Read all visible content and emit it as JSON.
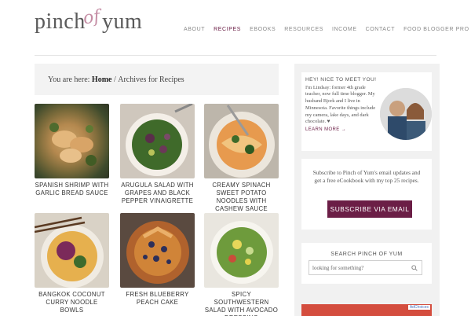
{
  "brand": {
    "word1": "pinch",
    "word2": "of",
    "word3": "yum"
  },
  "nav": {
    "items": [
      {
        "label": "ABOUT",
        "active": false
      },
      {
        "label": "RECIPES",
        "active": true
      },
      {
        "label": "EBOOKS",
        "active": false
      },
      {
        "label": "RESOURCES",
        "active": false
      },
      {
        "label": "INCOME",
        "active": false
      },
      {
        "label": "CONTACT",
        "active": false
      },
      {
        "label": "FOOD BLOGGER PRO",
        "active": false
      }
    ]
  },
  "breadcrumb": {
    "prefix": "You are here: ",
    "home": "Home",
    "separator": " / ",
    "current": "Archives for Recipes"
  },
  "recipes": [
    {
      "title": "SPANISH SHRIMP WITH GARLIC BREAD SAUCE"
    },
    {
      "title": "ARUGULA SALAD WITH GRAPES AND BLACK PEPPER VINAIGRETTE"
    },
    {
      "title": "CREAMY SPINACH SWEET POTATO NOODLES WITH CASHEW SAUCE"
    },
    {
      "title": "BANGKOK COCONUT CURRY NOODLE BOWLS"
    },
    {
      "title": "FRESH BLUEBERRY PEACH CAKE"
    },
    {
      "title": "SPICY SOUTHWESTERN SALAD WITH AVOCADO DRESSING"
    }
  ],
  "sidebar": {
    "hello_heading": "HEY! NICE TO MEET YOU!",
    "hello_text": "I'm Lindsay: former 4th grade teacher, now full time blogger. My husband Bjork and I live in Minnesota. Favorite things include my camera, lake days, and dark chocolate. ♥",
    "learn_more": "LEARN MORE →",
    "subscribe_text": "Subscribe to Pinch of Yum's email updates and get a free eCookbook with my top 25 recipes.",
    "subscribe_button": "SUBSCRIBE VIA EMAIL",
    "search_heading": "SEARCH PINCH OF YUM",
    "search_placeholder": "looking for something?",
    "ad_label": "AdChoices"
  },
  "colors": {
    "accent": "#6b1e46",
    "logo_of": "#c58ea5",
    "ad": "#d44d3e"
  }
}
